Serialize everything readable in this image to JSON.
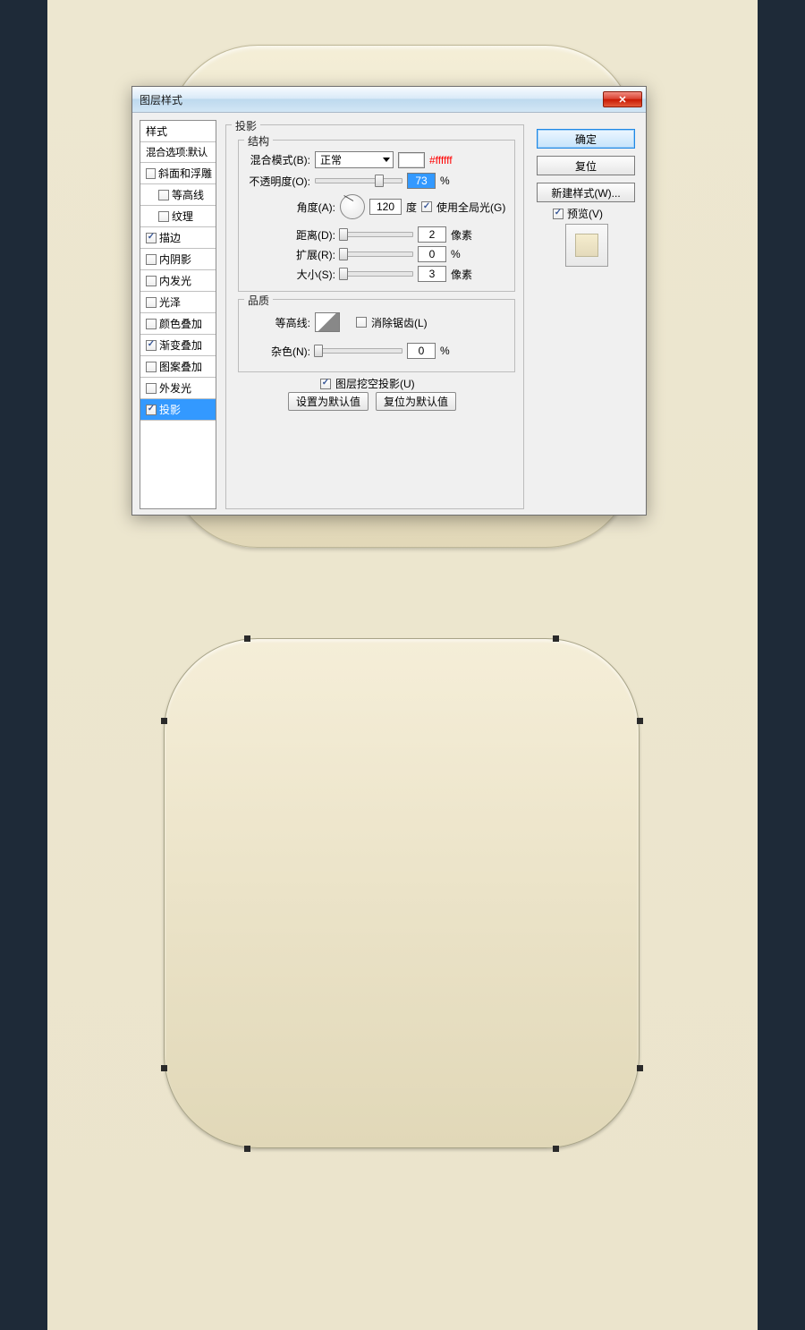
{
  "dialog": {
    "title": "图层样式",
    "close_glyph": "✕"
  },
  "sidebar": {
    "items": [
      {
        "label": "样式",
        "checked": null
      },
      {
        "label": "混合选项:默认",
        "checked": null
      },
      {
        "label": "斜面和浮雕",
        "checked": false
      },
      {
        "label": "等高线",
        "checked": false,
        "indent": true
      },
      {
        "label": "纹理",
        "checked": false,
        "indent": true
      },
      {
        "label": "描边",
        "checked": true
      },
      {
        "label": "内阴影",
        "checked": false
      },
      {
        "label": "内发光",
        "checked": false
      },
      {
        "label": "光泽",
        "checked": false
      },
      {
        "label": "颜色叠加",
        "checked": false
      },
      {
        "label": "渐变叠加",
        "checked": true
      },
      {
        "label": "图案叠加",
        "checked": false
      },
      {
        "label": "外发光",
        "checked": false
      },
      {
        "label": "投影",
        "checked": true,
        "selected": true
      }
    ]
  },
  "group_outer_legend": "投影",
  "group_struct_legend": "结构",
  "group_quality_legend": "品质",
  "struct": {
    "blend_label": "混合模式(B):",
    "blend_value": "正常",
    "color_hex": "#ffffff",
    "opacity_label": "不透明度(O):",
    "opacity_value": "73",
    "opacity_unit": "%",
    "angle_label": "角度(A):",
    "angle_value": "120",
    "angle_unit": "度",
    "global_label": "使用全局光(G)",
    "global_checked": true,
    "distance_label": "距离(D):",
    "distance_value": "2",
    "distance_unit": "像素",
    "spread_label": "扩展(R):",
    "spread_value": "0",
    "spread_unit": "%",
    "size_label": "大小(S):",
    "size_value": "3",
    "size_unit": "像素"
  },
  "quality": {
    "contour_label": "等高线:",
    "antialias_label": "消除锯齿(L)",
    "antialias_checked": false,
    "noise_label": "杂色(N):",
    "noise_value": "0",
    "noise_unit": "%"
  },
  "knockout": {
    "label": "图层挖空投影(U)",
    "checked": true
  },
  "sub_buttons": {
    "set_default": "设置为默认值",
    "reset_default": "复位为默认值"
  },
  "right": {
    "ok": "确定",
    "cancel": "复位",
    "new_style": "新建样式(W)...",
    "preview_label": "预览(V)",
    "preview_checked": true
  }
}
